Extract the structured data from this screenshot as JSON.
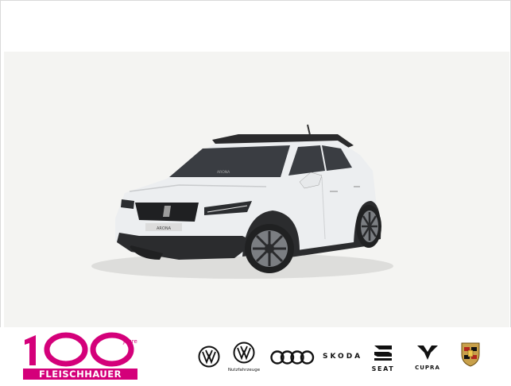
{
  "logo": {
    "number": "100",
    "superscript": "Jahre",
    "name": "FLEISCHHAUER"
  },
  "car": {
    "badge": "ARONA"
  },
  "brands": [
    {
      "name": "Volkswagen",
      "icon": "vw-logo-icon"
    },
    {
      "name": "Volkswagen Nutzfahrzeuge",
      "caption": "Nutzfahrzeuge",
      "icon": "vw-commercial-logo-icon"
    },
    {
      "name": "Audi",
      "icon": "audi-rings-icon"
    },
    {
      "name": "Skoda",
      "text": "SKODA",
      "icon": "skoda-wordmark"
    },
    {
      "name": "Seat",
      "text": "SEAT",
      "icon": "seat-logo-icon"
    },
    {
      "name": "Cupra",
      "text": "CUPRA",
      "icon": "cupra-logo-icon"
    },
    {
      "name": "Porsche",
      "icon": "porsche-crest-icon"
    }
  ],
  "colors": {
    "brand_magenta": "#d4007a",
    "photo_background": "#f4f4f2",
    "car_body": "#eceef0",
    "car_roof": "#2a2a2c"
  }
}
